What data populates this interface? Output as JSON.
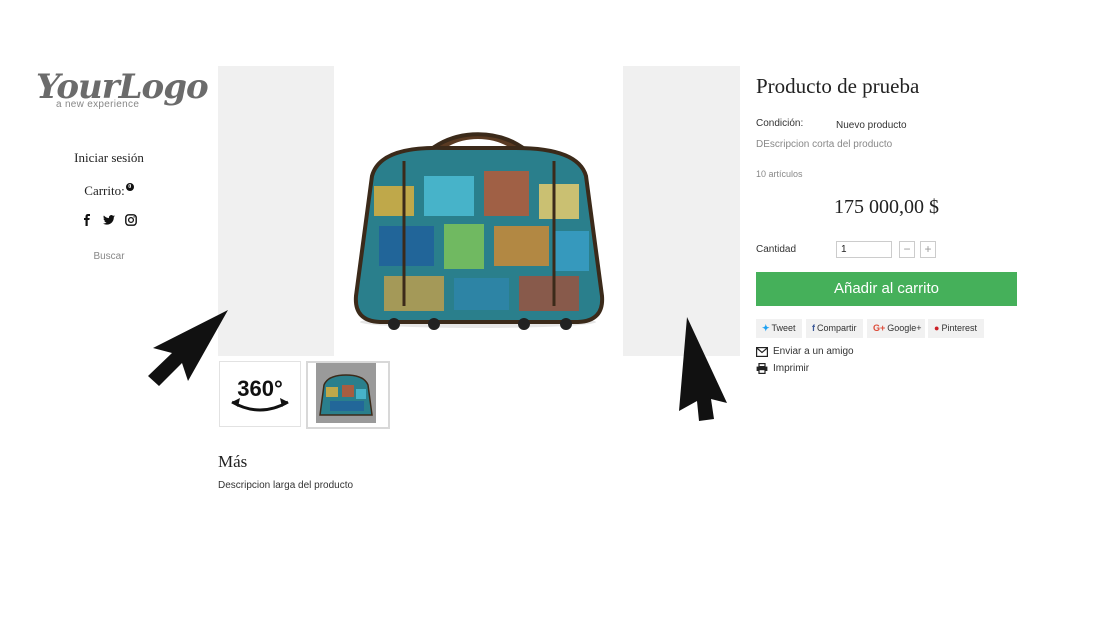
{
  "brand": {
    "logo_text": "YourLogo",
    "tagline": "a new experience"
  },
  "left_nav": {
    "login": "Iniciar sesión",
    "cart_label": "Carrito:",
    "cart_count": "0",
    "social_icons": [
      "facebook-icon",
      "twitter-icon",
      "instagram-icon"
    ],
    "search": "Buscar"
  },
  "product": {
    "title": "Producto de prueba",
    "condition_label": "Condición:",
    "condition_value": "Nuevo producto",
    "short_description": "DEscripcion corta del producto",
    "stock": "10 artículos",
    "price": "175 000,00 $",
    "quantity_label": "Cantidad",
    "quantity_value": "1",
    "add_to_cart": "Añadir al carrito",
    "share": {
      "tweet": "Tweet",
      "facebook": "Compartir",
      "google": "Google+",
      "pinterest": "Pinterest"
    },
    "send_friend": "Enviar a un amigo",
    "print": "Imprimir",
    "more_title": "Más",
    "long_description": "Descripcion larga del producto",
    "thumb_360_text": "360°"
  },
  "colors": {
    "add_to_cart_bg": "#45b05a",
    "twitter": "#1da1f2",
    "facebook": "#3b5998",
    "google": "#dd4b39",
    "pinterest": "#cb2027"
  }
}
